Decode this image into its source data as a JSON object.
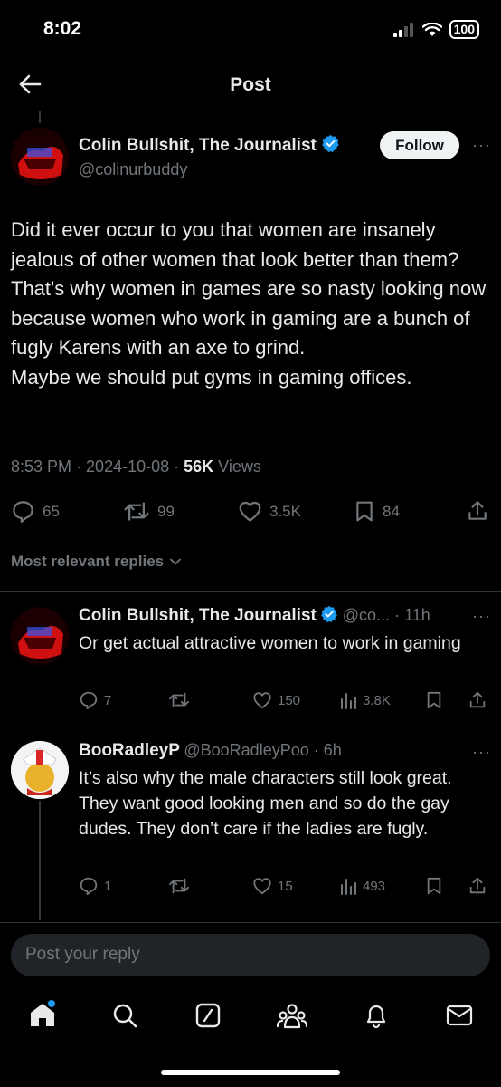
{
  "status": {
    "time": "8:02",
    "battery": "100"
  },
  "header": {
    "title": "Post"
  },
  "post": {
    "author_name": "Colin Bullshit, The Journalist",
    "author_handle": "@colinurbuddy",
    "follow_label": "Follow",
    "text_lines": [
      "Did it ever occur to you that women are insanely jealous of other women that look better than them?",
      "That's why women in games are so nasty looking now because women who work in gaming are a bunch of fugly Karens with an axe to grind.",
      "Maybe we should put gyms in gaming offices."
    ],
    "time": "8:53 PM",
    "date": "2024-10-08",
    "views_count": "56K",
    "views_label": "Views",
    "stats": {
      "replies": "65",
      "reposts": "99",
      "likes": "3.5K",
      "bookmarks": "84"
    }
  },
  "replies_section": {
    "label": "Most relevant replies"
  },
  "replies": [
    {
      "name": "Colin Bullshit, The Journalist",
      "handle": "@co...",
      "time": "11h",
      "text": "Or get actual attractive women to work in gaming",
      "stats": {
        "replies": "7",
        "reposts": "",
        "likes": "150",
        "views": "3.8K"
      }
    },
    {
      "name": "BooRadleyP",
      "handle": "@BooRadleyPoo",
      "time": "6h",
      "text": "It’s also why the male characters still look great. They want good looking men and so do the gay dudes. They don’t care if the ladies are fugly.",
      "stats": {
        "replies": "1",
        "reposts": "",
        "likes": "15",
        "views": "493"
      }
    }
  ],
  "composer": {
    "placeholder": "Post your reply"
  },
  "colors": {
    "background": "#000000",
    "accent": "#1d9bf0",
    "muted": "#71767b",
    "text": "#e7e9ea"
  }
}
